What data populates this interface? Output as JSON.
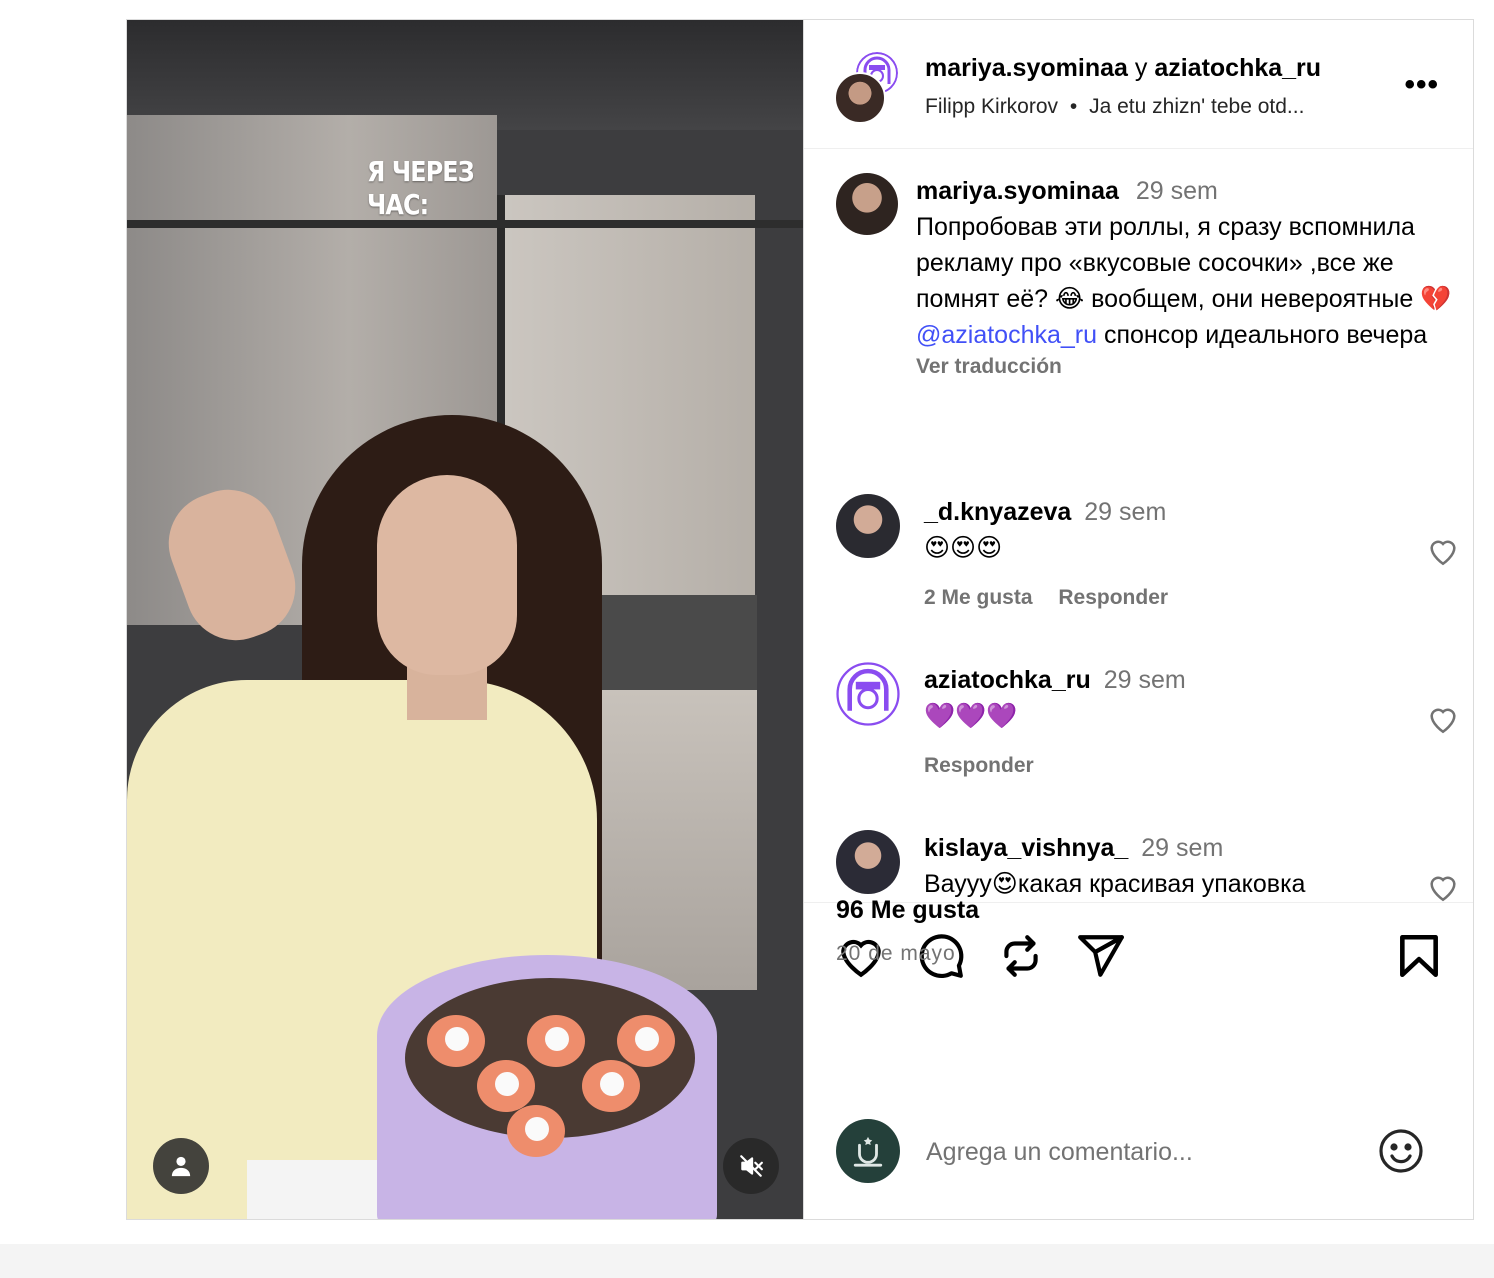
{
  "media": {
    "overlay_text": "Я ЧЕРЕЗ ЧАС:"
  },
  "header": {
    "author": "mariya.syominaa",
    "connector": "y",
    "coauthor": "aziatochka_ru",
    "music_artist": "Filipp Kirkorov",
    "music_separator": "•",
    "music_title": "Ja etu zhizn' tebe otd...",
    "more_label": "•••"
  },
  "caption": {
    "username": "mariya.syominaa",
    "time": "29 sem",
    "text_1": "Попробовав эти роллы, я сразу вспомнила рекламу про «вкусовые сосочки» ,все же помнят её? 😂 вообщем, они невероятные 💔",
    "mention": "@aziatochka_ru",
    "text_2": " спонсор идеального вечера",
    "translate": "Ver traducción"
  },
  "comments": [
    {
      "username": "_d.knyazeva",
      "time": "29 sem",
      "text": "😍😍😍",
      "likes": "2 Me gusta",
      "reply": "Responder"
    },
    {
      "username": "aziatochka_ru",
      "time": "29 sem",
      "text": "💜💜💜",
      "reply": "Responder"
    },
    {
      "username": "kislaya_vishnya_",
      "time": "29 sem",
      "text": "Вауyy😍какая красивая упаковка"
    }
  ],
  "stats": {
    "likes": "96 Me gusta",
    "date": "20 de mayo"
  },
  "add_comment": {
    "placeholder": "Agrega un comentario..."
  },
  "icons": [
    "like-icon",
    "comment-icon",
    "repost-icon",
    "share-icon",
    "save-icon",
    "emoji-icon",
    "user-icon",
    "mute-icon"
  ]
}
